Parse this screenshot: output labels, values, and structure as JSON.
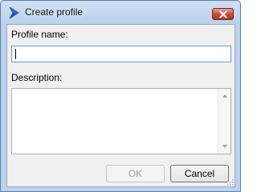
{
  "window": {
    "title": "Create profile",
    "app_icon": "bricscad-logo-icon",
    "close_icon": "close-icon"
  },
  "form": {
    "profile_name_label": "Profile name:",
    "profile_name_value": "",
    "description_label": "Description:",
    "description_value": ""
  },
  "buttons": {
    "ok_label": "OK",
    "cancel_label": "Cancel"
  },
  "colors": {
    "titlebar": "#bcd2ec",
    "close_button": "#cf4d3a",
    "focus_border": "#5b9bd5",
    "disabled_text": "#9a9a9a"
  }
}
